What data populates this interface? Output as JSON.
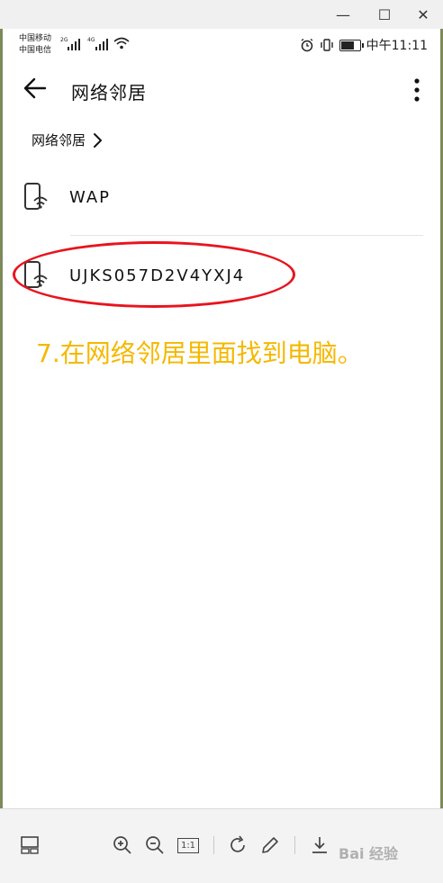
{
  "window": {
    "minimize_glyph": "—",
    "maximize_glyph": "☐",
    "close_glyph": "✕"
  },
  "status_bar": {
    "carrier_1": "中国移动",
    "carrier_2": "中国电信",
    "signal_1_type": "2G",
    "signal_2_type": "4G",
    "time": "中午11:11",
    "battery_level": 0.75
  },
  "app_bar": {
    "title": "网络邻居"
  },
  "breadcrumb": {
    "label": "网络邻居"
  },
  "devices": [
    {
      "name": "WAP"
    },
    {
      "name": "UJKS057D2V4YXJ4"
    }
  ],
  "annotation": {
    "caption": "7.在网络邻居里面找到电脑。"
  },
  "viewer_toolbar": {
    "actual_size_label": "1:1"
  },
  "watermark": {
    "text": "Bai 经验"
  }
}
